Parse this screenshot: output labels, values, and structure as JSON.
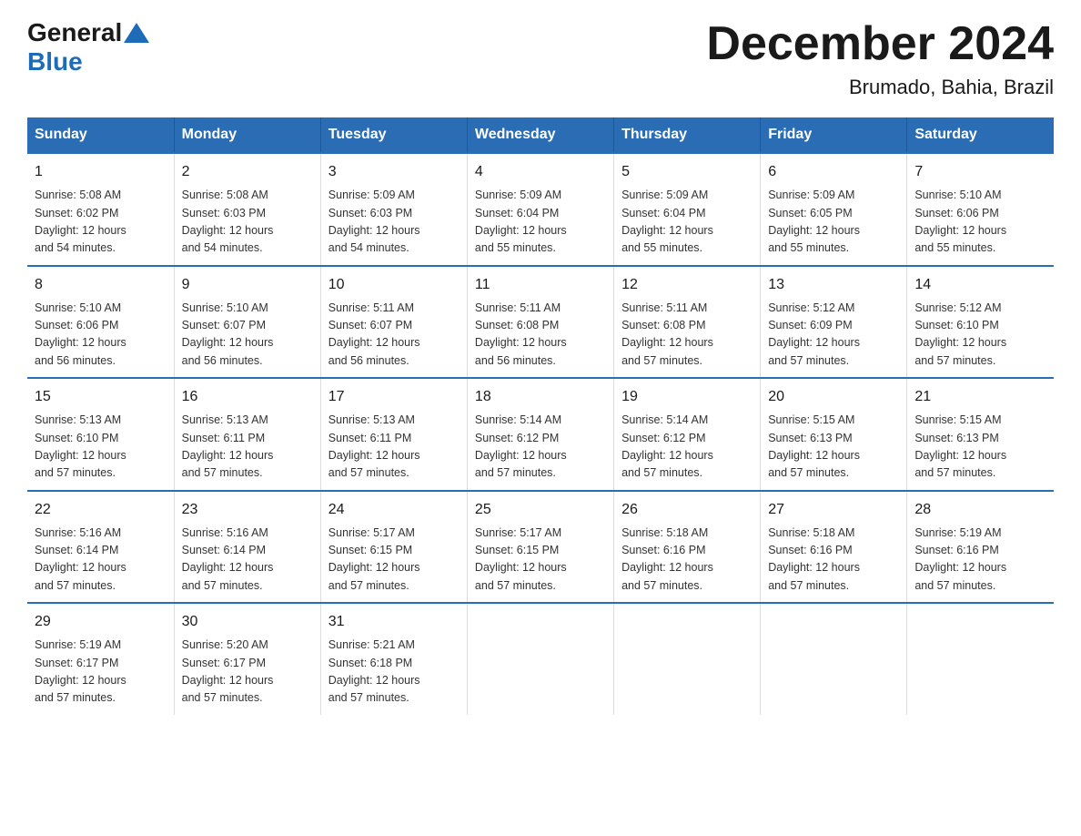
{
  "header": {
    "logo_general": "General",
    "logo_blue": "Blue",
    "month_title": "December 2024",
    "location": "Brumado, Bahia, Brazil"
  },
  "days_of_week": [
    "Sunday",
    "Monday",
    "Tuesday",
    "Wednesday",
    "Thursday",
    "Friday",
    "Saturday"
  ],
  "weeks": [
    [
      {
        "day": "1",
        "sunrise": "5:08 AM",
        "sunset": "6:02 PM",
        "daylight": "12 hours and 54 minutes."
      },
      {
        "day": "2",
        "sunrise": "5:08 AM",
        "sunset": "6:03 PM",
        "daylight": "12 hours and 54 minutes."
      },
      {
        "day": "3",
        "sunrise": "5:09 AM",
        "sunset": "6:03 PM",
        "daylight": "12 hours and 54 minutes."
      },
      {
        "day": "4",
        "sunrise": "5:09 AM",
        "sunset": "6:04 PM",
        "daylight": "12 hours and 55 minutes."
      },
      {
        "day": "5",
        "sunrise": "5:09 AM",
        "sunset": "6:04 PM",
        "daylight": "12 hours and 55 minutes."
      },
      {
        "day": "6",
        "sunrise": "5:09 AM",
        "sunset": "6:05 PM",
        "daylight": "12 hours and 55 minutes."
      },
      {
        "day": "7",
        "sunrise": "5:10 AM",
        "sunset": "6:06 PM",
        "daylight": "12 hours and 55 minutes."
      }
    ],
    [
      {
        "day": "8",
        "sunrise": "5:10 AM",
        "sunset": "6:06 PM",
        "daylight": "12 hours and 56 minutes."
      },
      {
        "day": "9",
        "sunrise": "5:10 AM",
        "sunset": "6:07 PM",
        "daylight": "12 hours and 56 minutes."
      },
      {
        "day": "10",
        "sunrise": "5:11 AM",
        "sunset": "6:07 PM",
        "daylight": "12 hours and 56 minutes."
      },
      {
        "day": "11",
        "sunrise": "5:11 AM",
        "sunset": "6:08 PM",
        "daylight": "12 hours and 56 minutes."
      },
      {
        "day": "12",
        "sunrise": "5:11 AM",
        "sunset": "6:08 PM",
        "daylight": "12 hours and 57 minutes."
      },
      {
        "day": "13",
        "sunrise": "5:12 AM",
        "sunset": "6:09 PM",
        "daylight": "12 hours and 57 minutes."
      },
      {
        "day": "14",
        "sunrise": "5:12 AM",
        "sunset": "6:10 PM",
        "daylight": "12 hours and 57 minutes."
      }
    ],
    [
      {
        "day": "15",
        "sunrise": "5:13 AM",
        "sunset": "6:10 PM",
        "daylight": "12 hours and 57 minutes."
      },
      {
        "day": "16",
        "sunrise": "5:13 AM",
        "sunset": "6:11 PM",
        "daylight": "12 hours and 57 minutes."
      },
      {
        "day": "17",
        "sunrise": "5:13 AM",
        "sunset": "6:11 PM",
        "daylight": "12 hours and 57 minutes."
      },
      {
        "day": "18",
        "sunrise": "5:14 AM",
        "sunset": "6:12 PM",
        "daylight": "12 hours and 57 minutes."
      },
      {
        "day": "19",
        "sunrise": "5:14 AM",
        "sunset": "6:12 PM",
        "daylight": "12 hours and 57 minutes."
      },
      {
        "day": "20",
        "sunrise": "5:15 AM",
        "sunset": "6:13 PM",
        "daylight": "12 hours and 57 minutes."
      },
      {
        "day": "21",
        "sunrise": "5:15 AM",
        "sunset": "6:13 PM",
        "daylight": "12 hours and 57 minutes."
      }
    ],
    [
      {
        "day": "22",
        "sunrise": "5:16 AM",
        "sunset": "6:14 PM",
        "daylight": "12 hours and 57 minutes."
      },
      {
        "day": "23",
        "sunrise": "5:16 AM",
        "sunset": "6:14 PM",
        "daylight": "12 hours and 57 minutes."
      },
      {
        "day": "24",
        "sunrise": "5:17 AM",
        "sunset": "6:15 PM",
        "daylight": "12 hours and 57 minutes."
      },
      {
        "day": "25",
        "sunrise": "5:17 AM",
        "sunset": "6:15 PM",
        "daylight": "12 hours and 57 minutes."
      },
      {
        "day": "26",
        "sunrise": "5:18 AM",
        "sunset": "6:16 PM",
        "daylight": "12 hours and 57 minutes."
      },
      {
        "day": "27",
        "sunrise": "5:18 AM",
        "sunset": "6:16 PM",
        "daylight": "12 hours and 57 minutes."
      },
      {
        "day": "28",
        "sunrise": "5:19 AM",
        "sunset": "6:16 PM",
        "daylight": "12 hours and 57 minutes."
      }
    ],
    [
      {
        "day": "29",
        "sunrise": "5:19 AM",
        "sunset": "6:17 PM",
        "daylight": "12 hours and 57 minutes."
      },
      {
        "day": "30",
        "sunrise": "5:20 AM",
        "sunset": "6:17 PM",
        "daylight": "12 hours and 57 minutes."
      },
      {
        "day": "31",
        "sunrise": "5:21 AM",
        "sunset": "6:18 PM",
        "daylight": "12 hours and 57 minutes."
      },
      null,
      null,
      null,
      null
    ]
  ],
  "labels": {
    "sunrise": "Sunrise:",
    "sunset": "Sunset:",
    "daylight": "Daylight:"
  }
}
